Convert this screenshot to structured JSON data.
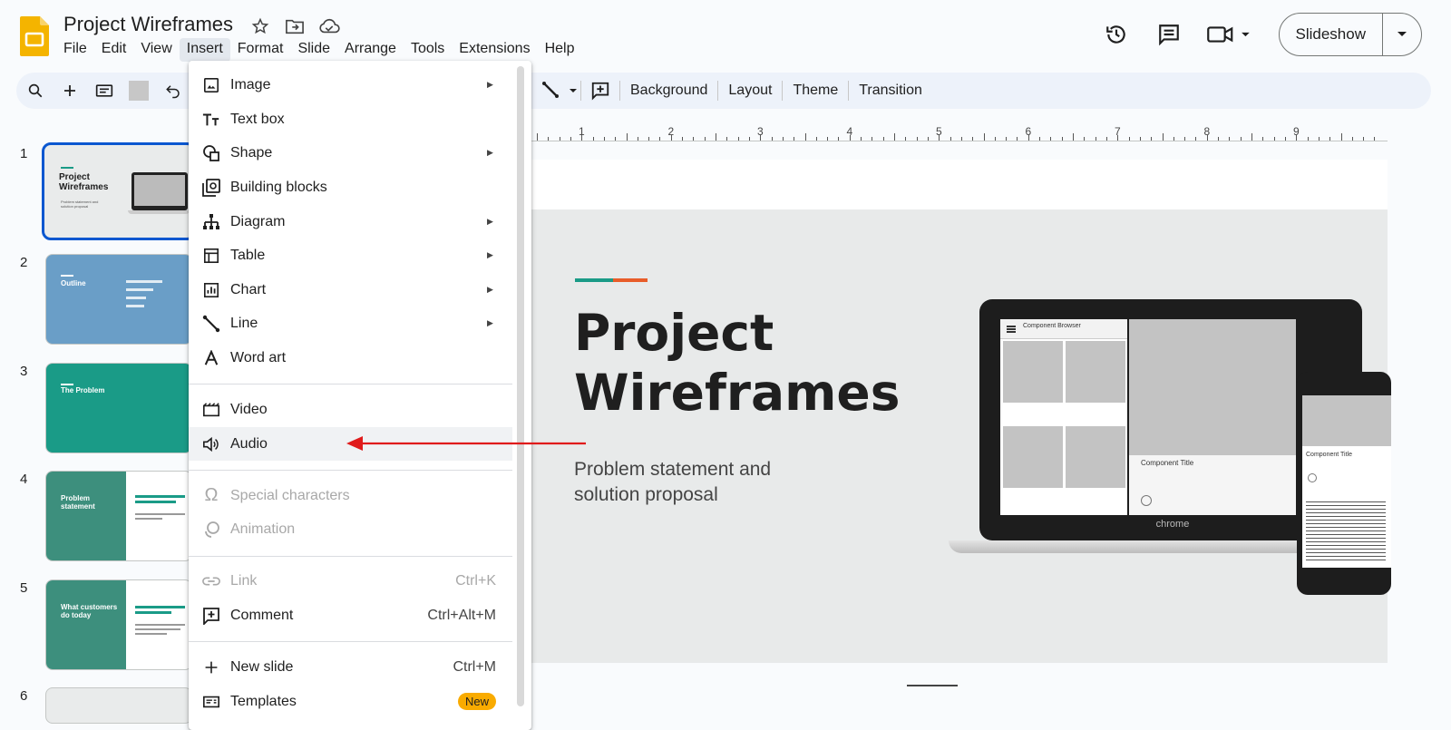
{
  "doc": {
    "title": "Project Wireframes"
  },
  "menubar": [
    "File",
    "Edit",
    "View",
    "Insert",
    "Format",
    "Slide",
    "Arrange",
    "Tools",
    "Extensions",
    "Help"
  ],
  "active_menu": "Insert",
  "header": {
    "slideshow_label": "Slideshow"
  },
  "toolbar": {
    "background": "Background",
    "layout": "Layout",
    "theme": "Theme",
    "transition": "Transition"
  },
  "ruler": [
    "1",
    "2",
    "3",
    "4",
    "5",
    "6",
    "7",
    "8",
    "9"
  ],
  "filmstrip": [
    {
      "num": "1",
      "title": "Project Wireframes",
      "sub": "Problem statement and solution proposal"
    },
    {
      "num": "2",
      "title": "Outline"
    },
    {
      "num": "3",
      "title": "The Problem"
    },
    {
      "num": "4",
      "title": "Problem statement"
    },
    {
      "num": "5",
      "title": "What customers do today"
    },
    {
      "num": "6",
      "title": ""
    }
  ],
  "slide": {
    "title_line1": "Project",
    "title_line2": "Wireframes",
    "subtitle_line1": "Problem statement and",
    "subtitle_line2": "solution proposal",
    "laptop_brand": "chrome",
    "browser_title": "Component Browser",
    "component_title": "Component Title"
  },
  "insert_menu": {
    "items": [
      {
        "label": "Image",
        "icon": "image-icon",
        "submenu": true
      },
      {
        "label": "Text box",
        "icon": "text-box-icon",
        "submenu": false
      },
      {
        "label": "Shape",
        "icon": "shape-icon",
        "submenu": true
      },
      {
        "label": "Building blocks",
        "icon": "building-blocks-icon",
        "submenu": false
      },
      {
        "label": "Diagram",
        "icon": "diagram-icon",
        "submenu": true
      },
      {
        "label": "Table",
        "icon": "table-icon",
        "submenu": true
      },
      {
        "label": "Chart",
        "icon": "chart-icon",
        "submenu": true
      },
      {
        "label": "Line",
        "icon": "line-icon",
        "submenu": true
      },
      {
        "label": "Word art",
        "icon": "word-art-icon",
        "submenu": false
      },
      {
        "label": "Video",
        "icon": "video-icon",
        "submenu": false
      },
      {
        "label": "Audio",
        "icon": "audio-icon",
        "submenu": false
      },
      {
        "label": "Special characters",
        "icon": "omega-icon",
        "disabled": true
      },
      {
        "label": "Animation",
        "icon": "animation-icon",
        "disabled": true
      },
      {
        "label": "Link",
        "icon": "link-icon",
        "shortcut": "Ctrl+K",
        "disabled": true
      },
      {
        "label": "Comment",
        "icon": "comment-icon",
        "shortcut": "Ctrl+Alt+M"
      },
      {
        "label": "New slide",
        "icon": "plus-icon",
        "shortcut": "Ctrl+M"
      },
      {
        "label": "Templates",
        "icon": "templates-icon",
        "badge": "New"
      }
    ]
  },
  "colors": {
    "accent_blue": "#0b57d0",
    "annotation_red": "#e01b1b",
    "teal": "#1a9b87",
    "orange": "#e85d2a",
    "badge_yellow": "#f9ab00"
  }
}
